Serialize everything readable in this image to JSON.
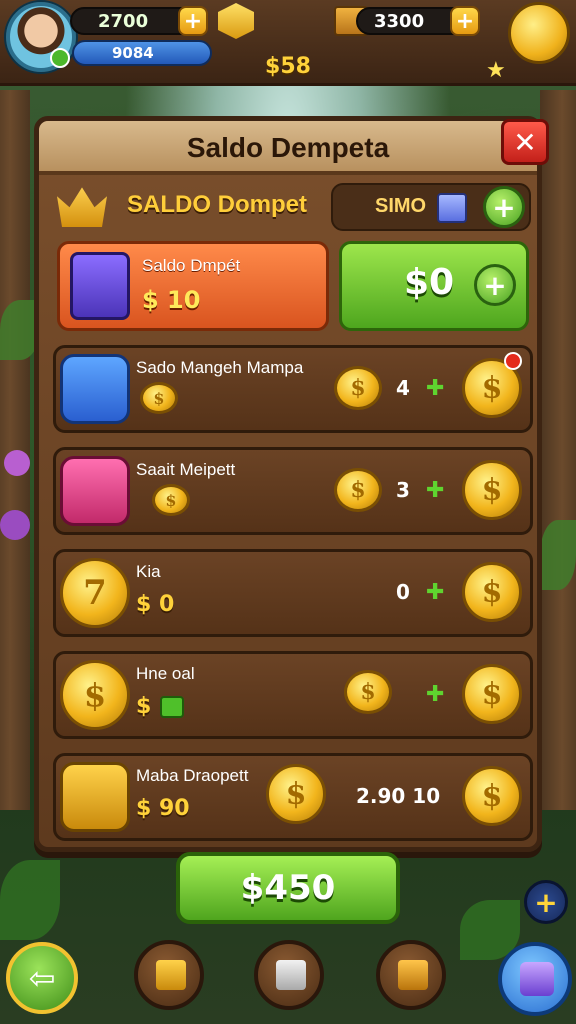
{
  "hud": {
    "gems": "2700",
    "xp_text": "9084",
    "cash": "3300",
    "plus_glyph": "+",
    "money": "$58"
  },
  "panel": {
    "title": "Saldo Dempeta",
    "close_glyph": "✕",
    "sub_title": "SALDO Dompet",
    "sub_chip_label": "SIMO",
    "plus_glyph": "+"
  },
  "feature": {
    "name": "Saldo Dmpét",
    "value": "$ 10",
    "green_value": "$0"
  },
  "rows": [
    {
      "name": "Sado Mangeh Mampa",
      "value": "",
      "count": "4",
      "coin_glyph": "$",
      "tag": "✚"
    },
    {
      "name": "Saait Meipett",
      "value": "",
      "count": "3",
      "coin_glyph": "$",
      "tag": "✚"
    },
    {
      "name": "Kia",
      "value": "$ 0",
      "count": "0",
      "coin_glyph": "$",
      "tag": "✚"
    },
    {
      "name": "Hne oal",
      "value": "$",
      "count": "",
      "coin_glyph": "$",
      "tag": "✚"
    },
    {
      "name": "Maba Draopett",
      "value": "$ 90",
      "count": "2.90 10",
      "coin_glyph": "$",
      "tag": ""
    }
  ],
  "bottom": {
    "buy_label": "$450",
    "back_glyph": "⇦",
    "fab_plus": "+"
  },
  "colors": {
    "accent_green": "#4fa51e",
    "accent_orange": "#d9541f",
    "gold": "#ffd23a",
    "panel_brown": "#5e3a1e",
    "close_red": "#c3201a"
  },
  "icons": [
    "avatar-icon",
    "gem-icon",
    "cash-icon",
    "shop-coin-icon",
    "crown-icon",
    "box-icon",
    "coin-icon",
    "back-arrow-icon",
    "gift-icon"
  ]
}
